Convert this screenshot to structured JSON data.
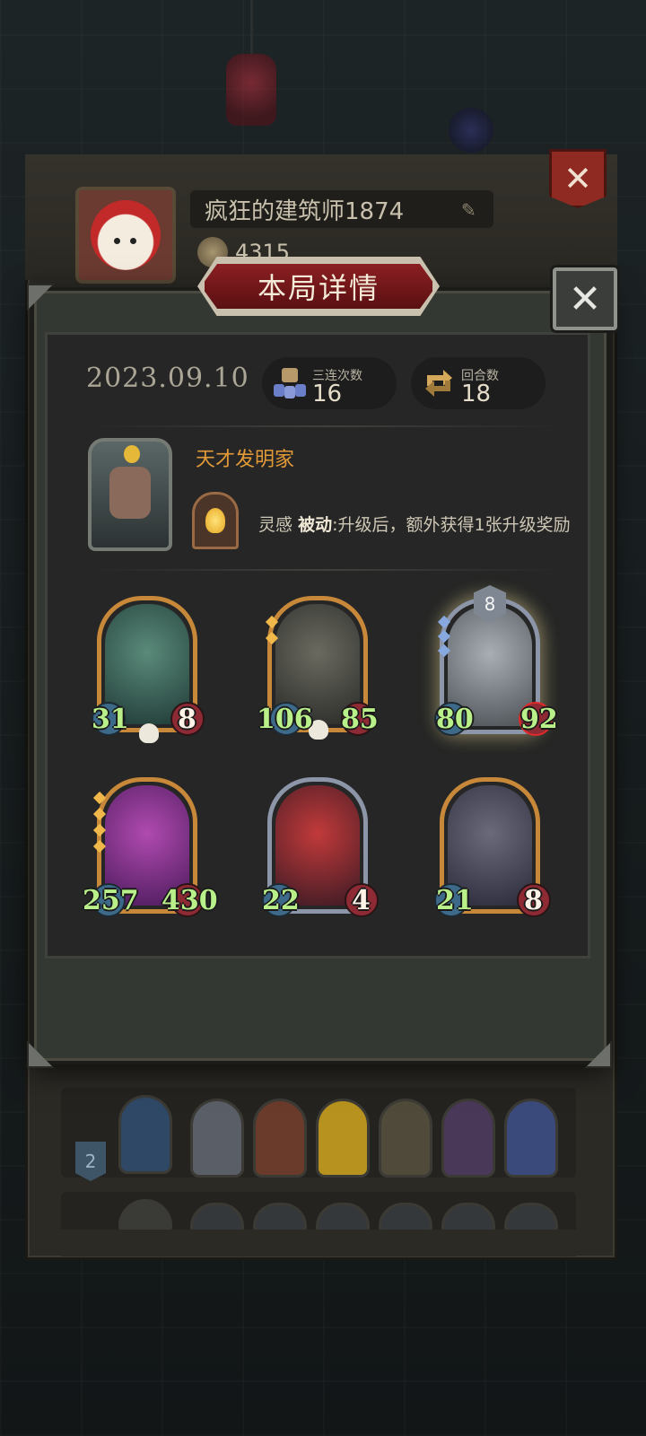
{
  "profile": {
    "player_name": "疯狂的建筑师1874",
    "coins": "4315"
  },
  "modal": {
    "title": "本局详情",
    "date": "2023.09.10",
    "triple_label": "三连次数",
    "triple_value": "16",
    "round_label": "回合数",
    "round_value": "18"
  },
  "hero": {
    "name": "天才发明家",
    "skill_name": "灵感",
    "skill_type": "被动",
    "skill_desc": ":升级后，额外获得1张升级奖励"
  },
  "units": [
    {
      "atk": "31",
      "hp": "8"
    },
    {
      "atk": "106",
      "hp": "85"
    },
    {
      "atk": "80",
      "hp": "92",
      "level": "8"
    },
    {
      "atk": "257",
      "hp": "430"
    },
    {
      "atk": "22",
      "hp": "4"
    },
    {
      "atk": "21",
      "hp": "8"
    }
  ],
  "history": {
    "rank": "2"
  }
}
